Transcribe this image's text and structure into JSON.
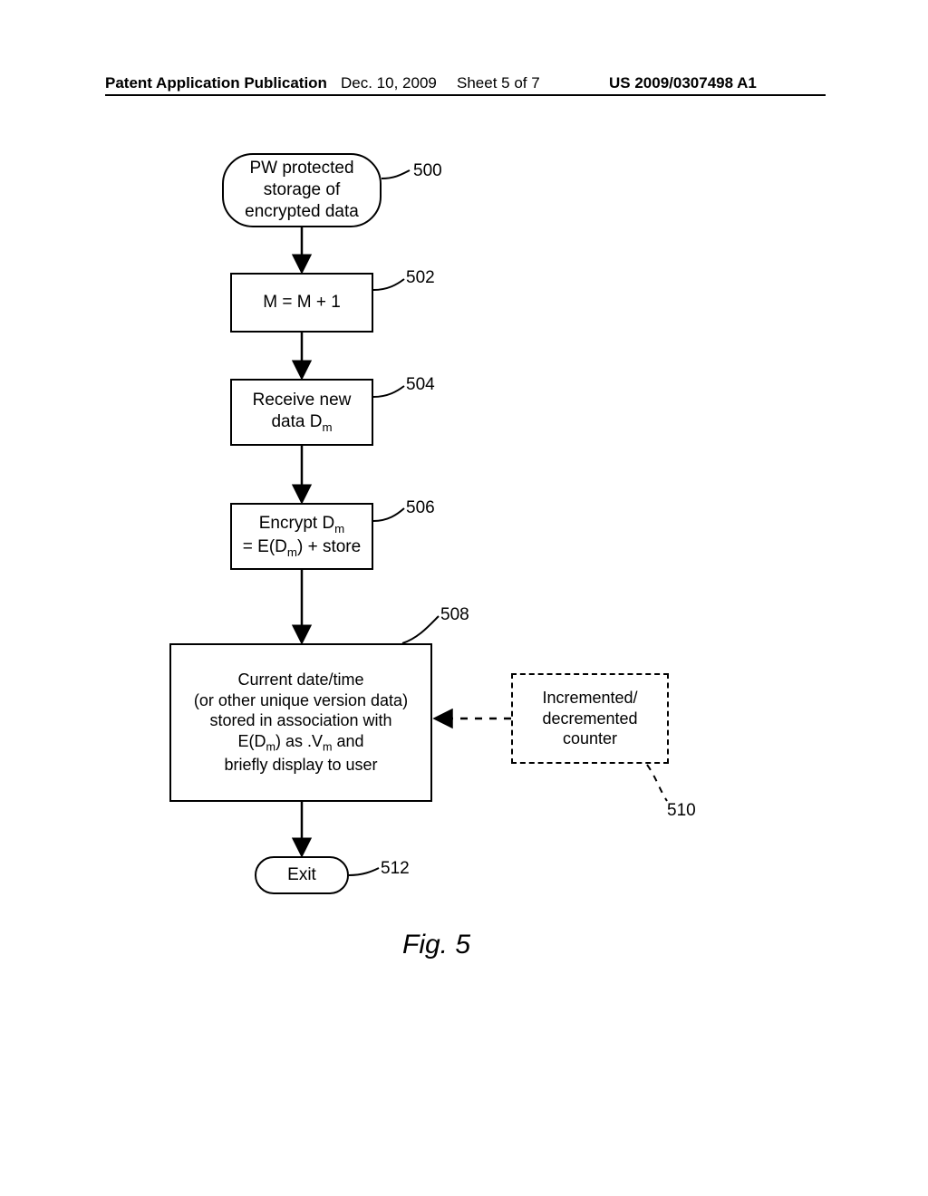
{
  "header": {
    "left": "Patent Application Publication",
    "mid_date": "Dec. 10, 2009",
    "mid_sheet": "Sheet 5 of 7",
    "right": "US 2009/0307498 A1"
  },
  "nodes": {
    "start": {
      "line1": "PW protected",
      "line2": "storage of",
      "line3": "encrypted data"
    },
    "step502": "M = M + 1",
    "step504": {
      "line1": "Receive new",
      "line2_prefix": "data D",
      "line2_sub": "m"
    },
    "step506": {
      "line1_prefix": "Encrypt D",
      "line1_sub": "m",
      "line2_prefix": "= E(D",
      "line2_sub": "m",
      "line2_suffix": ") + store"
    },
    "step508": {
      "line1": "Current date/time",
      "line2": "(or other unique version data)",
      "line3": "stored in association with",
      "line4_prefix": "E(D",
      "line4_sub1": "m",
      "line4_mid": ") as .V",
      "line4_sub2": "m",
      "line4_suffix": " and",
      "line5": "briefly display to user"
    },
    "step510": {
      "line1": "Incremented/",
      "line2": "decremented",
      "line3": "counter"
    },
    "exit": "Exit"
  },
  "labels": {
    "l500": "500",
    "l502": "502",
    "l504": "504",
    "l506": "506",
    "l508": "508",
    "l510": "510",
    "l512": "512"
  },
  "figure_caption": "Fig. 5"
}
